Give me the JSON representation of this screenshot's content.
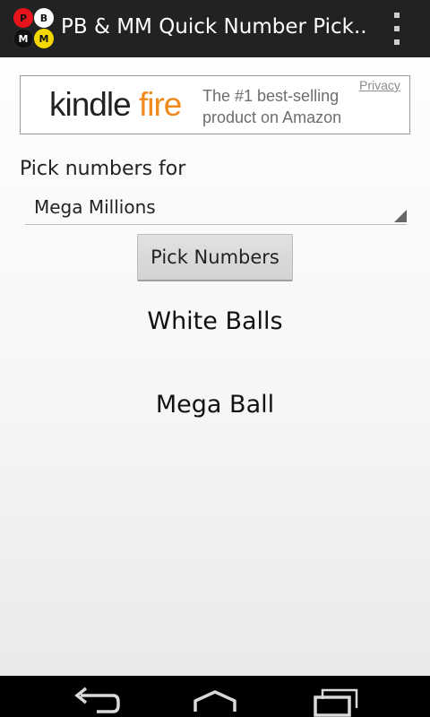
{
  "app": {
    "title": "PB & MM Quick Number Pick...",
    "icon_letters": [
      "P",
      "B",
      "M",
      "M"
    ],
    "icon_colors": {
      "powerball_red": "#e8141b",
      "ball_white": "#ffffff",
      "ball_black": "#111111",
      "megaball_yellow": "#f5d800"
    },
    "menu_icon": "overflow-menu-icon"
  },
  "ad": {
    "logo_word1": "kindle",
    "logo_word2": "fire",
    "tagline_line1": "The #1 best-selling",
    "tagline_line2": "product on Amazon",
    "privacy_label": "Privacy",
    "accent_color": "#f08a1c"
  },
  "form": {
    "pick_label": "Pick numbers for",
    "game_selected": "Mega Millions",
    "pick_button_label": "Pick Numbers"
  },
  "results": {
    "white_balls_heading": "White Balls",
    "mega_ball_heading": "Mega Ball"
  },
  "nav": {
    "back_icon": "back-icon",
    "home_icon": "home-icon",
    "recents_icon": "recents-icon"
  }
}
